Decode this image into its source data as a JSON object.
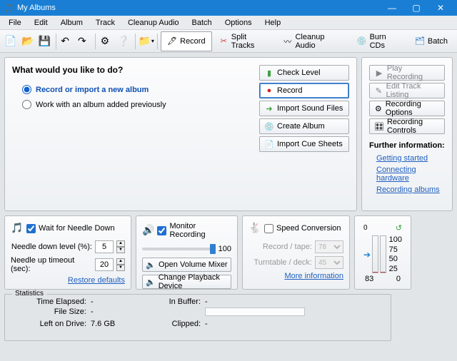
{
  "window": {
    "title": "My Albums"
  },
  "menu": [
    "File",
    "Edit",
    "Album",
    "Track",
    "Cleanup Audio",
    "Batch",
    "Options",
    "Help"
  ],
  "toolbar_tabs": {
    "record": "Record",
    "split": "Split Tracks",
    "cleanup": "Cleanup Audio",
    "burn": "Burn CDs",
    "batch": "Batch"
  },
  "main": {
    "heading": "What would you like to do?",
    "opt_record": "Record or import a new album",
    "opt_work": "Work with an album added previously"
  },
  "actions": {
    "check_level": "Check Level",
    "record": "Record",
    "import_sound": "Import Sound Files",
    "create_album": "Create Album",
    "import_cue": "Import Cue Sheets"
  },
  "side": {
    "play_recording": "Play Recording",
    "edit_track_listing": "Edit Track Listing",
    "recording_options": "Recording Options",
    "recording_controls": "Recording Controls",
    "further_heading": "Further information:",
    "link_getting_started": "Getting started",
    "link_hardware": "Connecting hardware",
    "link_albums": "Recording albums"
  },
  "needle": {
    "wait_label": "Wait for Needle Down",
    "level_label": "Needle down level (%):",
    "level_value": "5",
    "timeout_label": "Needle up timeout (sec):",
    "timeout_value": "20",
    "restore": "Restore defaults"
  },
  "monitor": {
    "label": "Monitor Recording",
    "volume": "100",
    "open_mixer": "Open Volume Mixer",
    "change_device": "Change Playback Device"
  },
  "speed": {
    "label": "Speed Conversion",
    "record_tape_label": "Record / tape:",
    "record_tape_value": "78",
    "turntable_label": "Turntable / deck:",
    "turntable_value": "45",
    "more": "More information"
  },
  "stats": {
    "legend": "Statistics",
    "time_elapsed_label": "Time Elapsed:",
    "time_elapsed_value": "-",
    "in_buffer_label": "In Buffer:",
    "in_buffer_value": "-",
    "file_size_label": "File Size:",
    "file_size_value": "-",
    "left_on_drive_label": "Left on Drive:",
    "left_on_drive_value": "7.6 GB",
    "clipped_label": "Clipped:",
    "clipped_value": "-"
  },
  "meter": {
    "zero": "0",
    "ticks": [
      "100",
      "75",
      "50",
      "25"
    ],
    "bottom_left": "83",
    "bottom_right": "0"
  }
}
